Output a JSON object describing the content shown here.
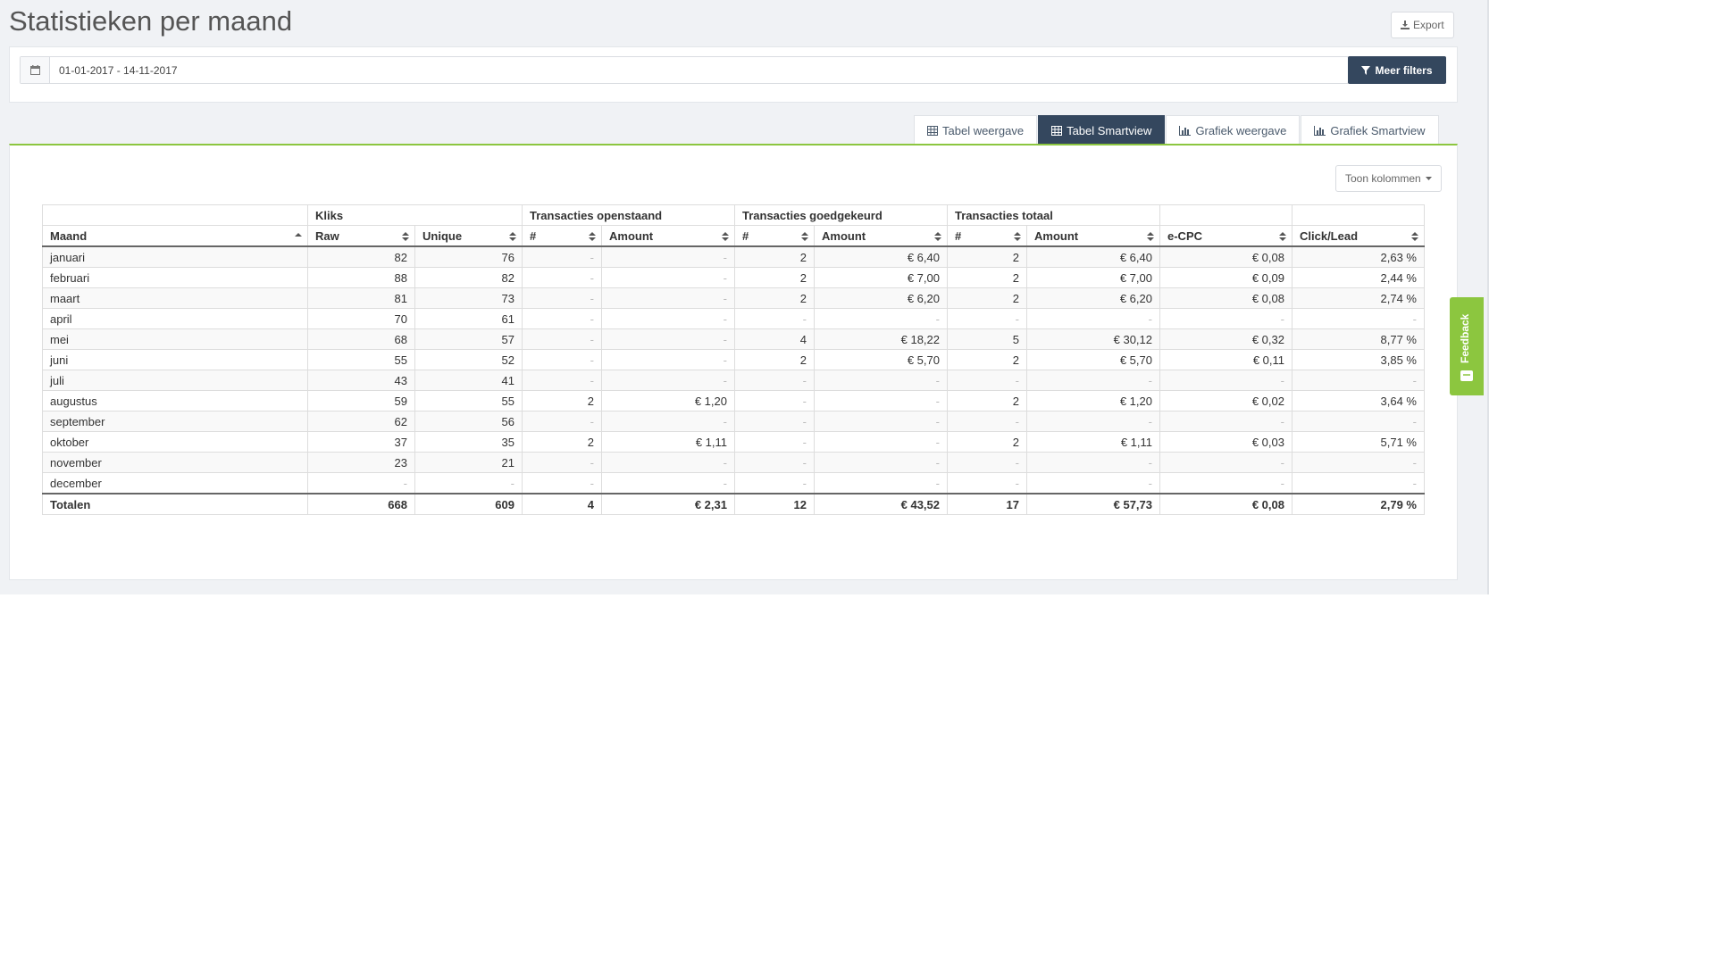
{
  "page": {
    "title": "Statistieken per maand"
  },
  "toolbar": {
    "export_label": "Export"
  },
  "filters": {
    "date_range": "01-01-2017 - 14-11-2017",
    "more_filters_label": "Meer filters"
  },
  "tabs": [
    {
      "label": "Tabel weergave",
      "icon": "table-icon",
      "active": false
    },
    {
      "label": "Tabel Smartview",
      "icon": "table-icon",
      "active": true
    },
    {
      "label": "Grafiek weergave",
      "icon": "bar-chart-icon",
      "active": false
    },
    {
      "label": "Grafiek Smartview",
      "icon": "bar-chart-icon",
      "active": false
    }
  ],
  "content": {
    "show_columns_label": "Toon kolommen"
  },
  "table": {
    "group_headers": [
      "",
      "Kliks",
      "Transacties openstaand",
      "Transacties goedgekeurd",
      "Transacties totaal",
      "",
      ""
    ],
    "columns": [
      "Maand",
      "Raw",
      "Unique",
      "#",
      "Amount",
      "#",
      "Amount",
      "#",
      "Amount",
      "e-CPC",
      "Click/Lead"
    ],
    "rows": [
      [
        "januari",
        "82",
        "76",
        "-",
        "-",
        "2",
        "€ 6,40",
        "2",
        "€ 6,40",
        "€ 0,08",
        "2,63 %"
      ],
      [
        "februari",
        "88",
        "82",
        "-",
        "-",
        "2",
        "€ 7,00",
        "2",
        "€ 7,00",
        "€ 0,09",
        "2,44 %"
      ],
      [
        "maart",
        "81",
        "73",
        "-",
        "-",
        "2",
        "€ 6,20",
        "2",
        "€ 6,20",
        "€ 0,08",
        "2,74 %"
      ],
      [
        "april",
        "70",
        "61",
        "-",
        "-",
        "-",
        "-",
        "-",
        "-",
        "-",
        "-"
      ],
      [
        "mei",
        "68",
        "57",
        "-",
        "-",
        "4",
        "€ 18,22",
        "5",
        "€ 30,12",
        "€ 0,32",
        "8,77 %"
      ],
      [
        "juni",
        "55",
        "52",
        "-",
        "-",
        "2",
        "€ 5,70",
        "2",
        "€ 5,70",
        "€ 0,11",
        "3,85 %"
      ],
      [
        "juli",
        "43",
        "41",
        "-",
        "-",
        "-",
        "-",
        "-",
        "-",
        "-",
        "-"
      ],
      [
        "augustus",
        "59",
        "55",
        "2",
        "€ 1,20",
        "-",
        "-",
        "2",
        "€ 1,20",
        "€ 0,02",
        "3,64 %"
      ],
      [
        "september",
        "62",
        "56",
        "-",
        "-",
        "-",
        "-",
        "-",
        "-",
        "-",
        "-"
      ],
      [
        "oktober",
        "37",
        "35",
        "2",
        "€ 1,11",
        "-",
        "-",
        "2",
        "€ 1,11",
        "€ 0,03",
        "5,71 %"
      ],
      [
        "november",
        "23",
        "21",
        "-",
        "-",
        "-",
        "-",
        "-",
        "-",
        "-",
        "-"
      ],
      [
        "december",
        "-",
        "-",
        "-",
        "-",
        "-",
        "-",
        "-",
        "-",
        "-",
        "-"
      ]
    ],
    "totals": [
      "Totalen",
      "668",
      "609",
      "4",
      "€ 2,31",
      "12",
      "€ 43,52",
      "17",
      "€ 57,73",
      "€ 0,08",
      "2,79 %"
    ]
  },
  "feedback": {
    "label": "Feedback"
  },
  "colors": {
    "accent_green": "#8cc63f",
    "dark_navy": "#34475e"
  }
}
